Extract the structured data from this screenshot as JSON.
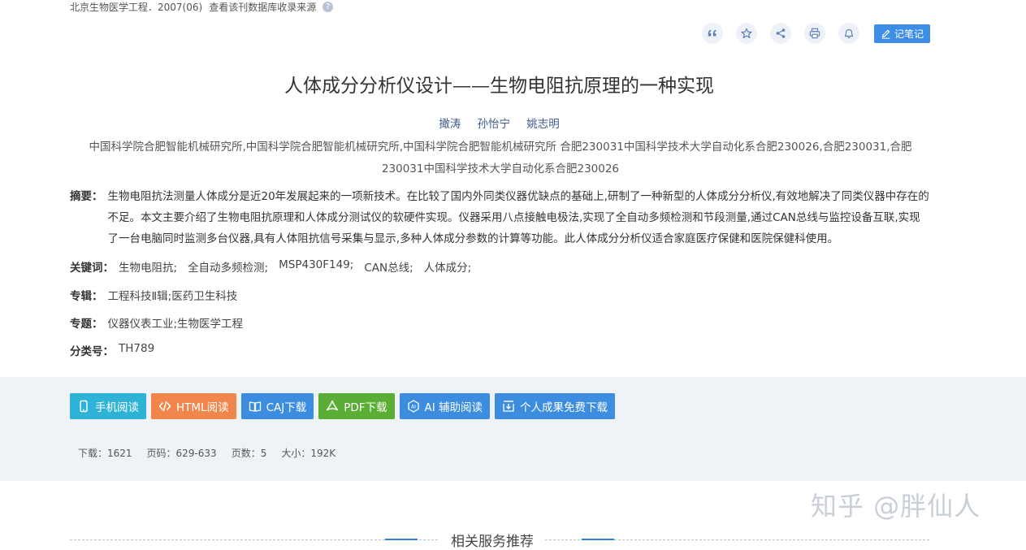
{
  "source": {
    "journal": "北京生物医学工程．2007(06)",
    "link": "查看该刊数据库收录来源",
    "help_icon": "question-icon"
  },
  "toolbar": {
    "icons": [
      "quote-icon",
      "star-icon",
      "share-icon",
      "print-icon",
      "bell-icon"
    ],
    "note_label": "记笔记"
  },
  "article": {
    "title": "人体成分分析仪设计——生物电阻抗原理的一种实现",
    "authors": [
      "撖涛",
      "孙怡宁",
      "姚志明"
    ],
    "affiliation": "中国科学院合肥智能机械研究所,中国科学院合肥智能机械研究所,中国科学院合肥智能机械研究所 合肥230031中国科学技术大学自动化系合肥230026,合肥230031,合肥230031中国科学技术大学自动化系合肥230026",
    "abstract_label": "摘要：",
    "abstract": "生物电阻抗法测量人体成分是近20年发展起来的一项新技术。在比较了国内外同类仪器优缺点的基础上,研制了一种新型的人体成分分析仪,有效地解决了同类仪器中存在的不足。本文主要介绍了生物电阻抗原理和人体成分测试仪的软硬件实现。仪器采用八点接触电极法,实现了全自动多频检测和节段测量,通过CAN总线与监控设备互联,实现了一台电脑同时监测多台仪器,具有人体阻抗信号采集与显示,多种人体成分参数的计算等功能。此人体成分分析仪适合家庭医疗保健和医院保健科使用。",
    "keywords_label": "关键词：",
    "keywords": [
      "生物电阻抗;",
      "全自动多频检测;",
      "MSP430F149;",
      "CAN总线;",
      "人体成分;"
    ],
    "series_label": "专辑：",
    "series": "工程科技Ⅱ辑;医药卫生科技",
    "topic_label": "专题：",
    "topic": "仪器仪表工业;生物医学工程",
    "class_label": "分类号：",
    "class": "TH789"
  },
  "actions": {
    "buttons": [
      {
        "label": "手机阅读",
        "icon": "phone-icon",
        "color": "#2eb3d6"
      },
      {
        "label": "HTML阅读",
        "icon": "code-icon",
        "color": "#f0864b"
      },
      {
        "label": "CAJ下载",
        "icon": "book-icon",
        "color": "#3c8de0"
      },
      {
        "label": "PDF下载",
        "icon": "pdf-icon",
        "color": "#5aae35"
      },
      {
        "label": "AI 辅助阅读",
        "icon": "ai-icon",
        "color": "#3c8de0"
      },
      {
        "label": "个人成果免费下载",
        "icon": "download-icon",
        "color": "#3c8de0"
      }
    ]
  },
  "stats": {
    "downloads": "下载：1621",
    "pages_range": "页码：629-633",
    "page_count": "页数：5",
    "size": "大小：192K"
  },
  "related": {
    "title": "相关服务推荐"
  },
  "watermark": "知乎 @胖仙人"
}
